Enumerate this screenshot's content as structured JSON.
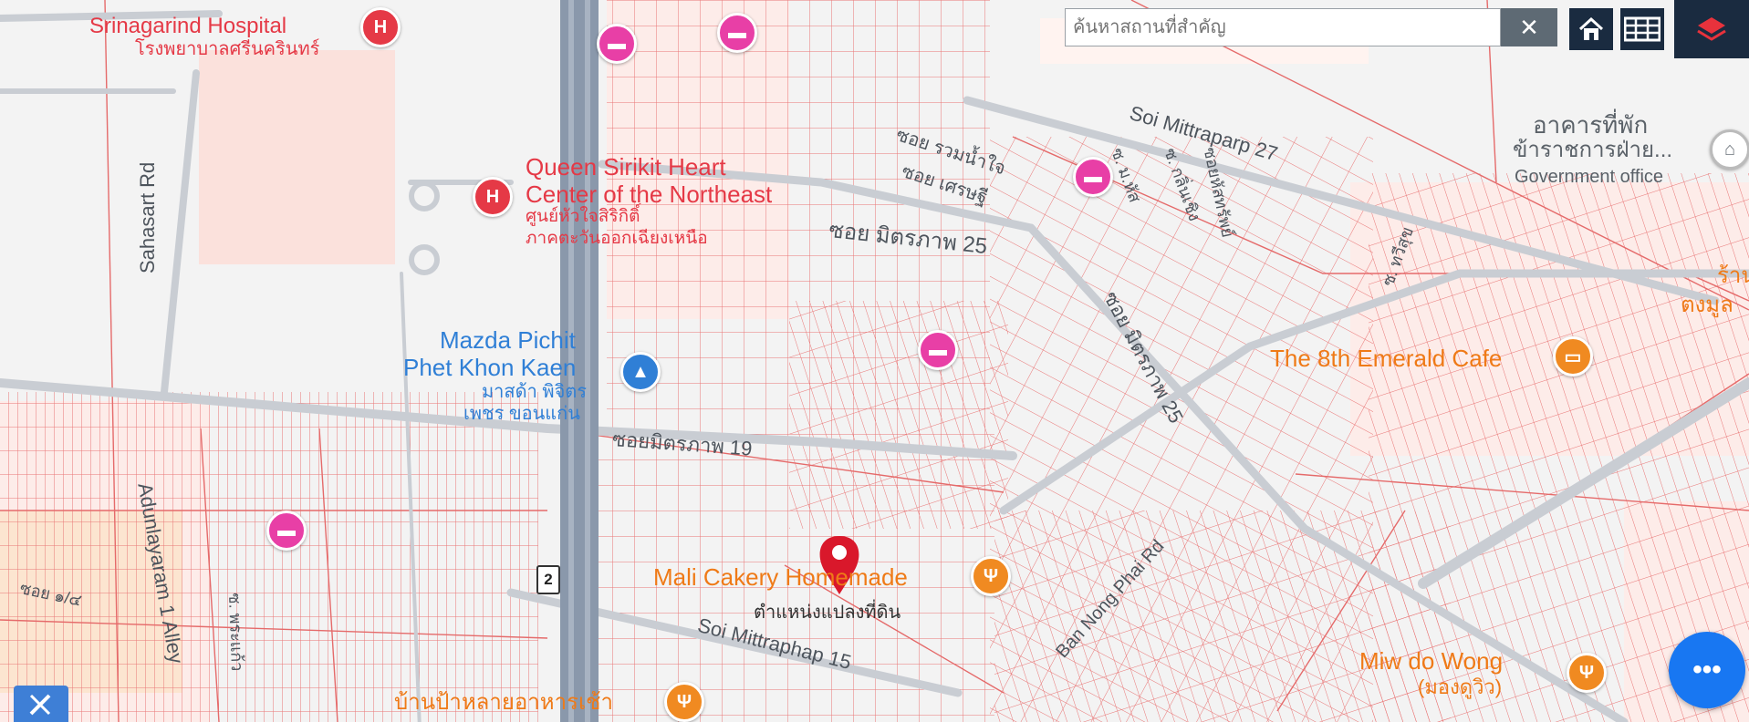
{
  "search": {
    "placeholder": "ค้นหาสถานที่สำคัญ",
    "value": ""
  },
  "toolbar": {
    "clear_label": "✕"
  },
  "labels": {
    "srinagarind_en": "Srinagarind Hospital",
    "srinagarind_th": "โรงพยาบาลศรีนครินทร์",
    "queen_en_1": "Queen Sirikit Heart",
    "queen_en_2": "Center of the Northeast",
    "queen_th_1": "ศูนย์หัวใจสิริกิติ์",
    "queen_th_2": "ภาคตะวันออกเฉียงเหนือ",
    "mazda_en_1": "Mazda Pichit",
    "mazda_en_2": "Phet Khon Kaen",
    "mazda_th_1": "มาสด้า พิจิตร",
    "mazda_th_2": "เพชร ขอนแก่น",
    "sahasart": "Sahasart Rd",
    "adunlayaram": "Adunlayaram 1 Alley",
    "soi_mittraparp_27": "Soi Mittraparp 27",
    "soi_th_rawamnamjai": "ซอย รวมน้ำใจ",
    "soi_th_setthi": "ซอย เศรษฐี",
    "soi_th_25": "ซอย มิตรภาพ 25",
    "soi_th_25_diag": "ซอย มิตรภาพ 25",
    "soi_th_19": "ซอยมิตรภาพ 19",
    "soi_mittraphap_15": "Soi Mittraphap 15",
    "ban_nong_phai": "Ban Nong Phai Rd",
    "gov_th_1": "อาคารที่พัก",
    "gov_th_2": "ข้าราชการฝ่าย...",
    "gov_en": "Government office",
    "emerald": "The 8th Emerald Cafe",
    "mali": "Mali Cakery Homemade",
    "plot_marker": "ตำแหน่งแปลงที่ดิน",
    "miw_1": "Miw do Wong",
    "miw_2": "(มองดูวิว)",
    "banpa": "บ้านป้าหลายอาหารเช้า",
    "route_no": "2",
    "edge_th_1": "ร้าน",
    "edge_th_2": "ตงมูล",
    "soi_th_side_1": "ซ. ม.หัส",
    "soi_th_side_2": "ซ. กลิ่นเชิง",
    "soi_th_side_3": "ซอยหัสทรัพย์",
    "soi_th_side_4": "ซ. ทวีสุข",
    "soi_th_left_1": "ซอย ๑/๔",
    "soi_th_left_2": "ซ. พระแก้ว"
  },
  "colors": {
    "parcel": "#e56a6a",
    "hospital_pin": "#e53946",
    "hotel_pin": "#e83fa6",
    "food_pin": "#f08a21",
    "shop_pin": "#2f7fd6",
    "location_pin": "#d9182b",
    "toolbar": "#1a2b40",
    "fab": "#1877f2"
  },
  "icons": {
    "home": "home-icon",
    "grid": "grid-icon",
    "layers": "layers-icon",
    "more": "more-icon",
    "draw": "pencil-ruler-icon"
  }
}
